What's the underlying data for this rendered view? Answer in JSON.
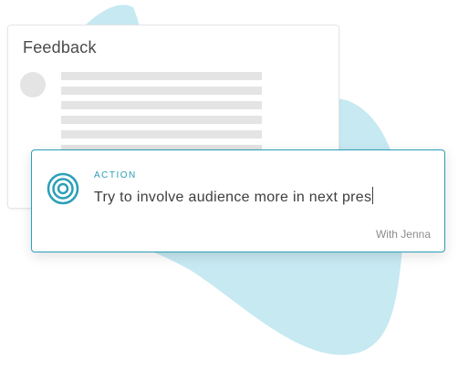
{
  "feedback_card": {
    "title": "Feedback"
  },
  "action_card": {
    "label": "ACTION",
    "input_value": "Try to involve audience more in next pres",
    "with_text": "With Jenna",
    "icon": "target-icon"
  },
  "colors": {
    "accent": "#2a9fb7",
    "blob": "#c6e9f2",
    "skeleton": "#e4e4e4"
  }
}
